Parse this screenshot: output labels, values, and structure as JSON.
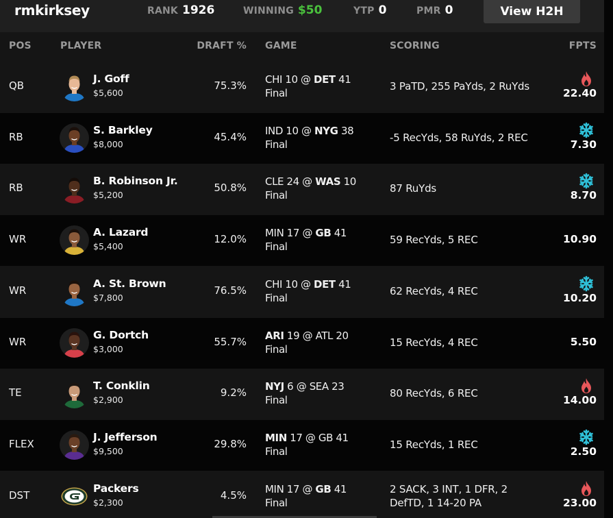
{
  "header": {
    "username": "rmkirksey",
    "rank_label": "RANK",
    "rank_value": "1926",
    "winning_label": "WINNING",
    "winning_value": "$50",
    "ytp_label": "YTP",
    "ytp_value": "0",
    "pmr_label": "PMR",
    "pmr_value": "0",
    "view_h2h_label": "View H2H"
  },
  "columns": {
    "pos": "POS",
    "player": "PLAYER",
    "draft": "DRAFT %",
    "game": "GAME",
    "scoring": "SCORING",
    "fpts": "FPTS"
  },
  "colors": {
    "winning_green": "#4ac13d",
    "hot_red": "#e8575a",
    "cold_cyan": "#2fc0d8"
  },
  "rows": [
    {
      "pos": "QB",
      "name": "J. Goff",
      "salary": "$5,600",
      "draft": "75.3%",
      "away": "CHI",
      "away_score": "10",
      "home": "DET",
      "home_score": "41",
      "bold_team": "home",
      "status": "Final",
      "scoring": "3 PaTD, 255 PaYds, 2 RuYds",
      "fpts": "22.40",
      "trend": "hot",
      "trend_icon": "flame-icon",
      "jersey": "#1f77c5",
      "skin": "#e7b896",
      "hair": "#b08a55"
    },
    {
      "pos": "RB",
      "name": "S. Barkley",
      "salary": "$8,000",
      "draft": "45.4%",
      "away": "IND",
      "away_score": "10",
      "home": "NYG",
      "home_score": "38",
      "bold_team": "home",
      "status": "Final",
      "scoring": "-5 RecYds, 58 RuYds, 2 REC",
      "fpts": "7.30",
      "trend": "cold",
      "trend_icon": "snowflake-icon",
      "jersey": "#2a4fc0",
      "skin": "#6b3f25",
      "hair": "#1a0f0a"
    },
    {
      "pos": "RB",
      "name": "B. Robinson Jr.",
      "salary": "$5,200",
      "draft": "50.8%",
      "away": "CLE",
      "away_score": "24",
      "home": "WAS",
      "home_score": "10",
      "bold_team": "home",
      "status": "Final",
      "scoring": "87 RuYds",
      "fpts": "8.70",
      "trend": "cold",
      "trend_icon": "snowflake-icon",
      "jersey": "#8a1d25",
      "skin": "#4f2e1c",
      "hair": "#140c08"
    },
    {
      "pos": "WR",
      "name": "A. Lazard",
      "salary": "$5,400",
      "draft": "12.0%",
      "away": "MIN",
      "away_score": "17",
      "home": "GB",
      "home_score": "41",
      "bold_team": "home",
      "status": "Final",
      "scoring": "59 RecYds, 5 REC",
      "fpts": "10.90",
      "trend": "none",
      "trend_icon": "",
      "jersey": "#d9b238",
      "skin": "#8a5a3a",
      "hair": "#1a100a"
    },
    {
      "pos": "WR",
      "name": "A. St. Brown",
      "salary": "$7,800",
      "draft": "76.5%",
      "away": "CHI",
      "away_score": "10",
      "home": "DET",
      "home_score": "41",
      "bold_team": "home",
      "status": "Final",
      "scoring": "62 RecYds, 4 REC",
      "fpts": "10.20",
      "trend": "cold",
      "trend_icon": "snowflake-icon",
      "jersey": "#1f77c5",
      "skin": "#9a6440",
      "hair": "#1a100a"
    },
    {
      "pos": "WR",
      "name": "G. Dortch",
      "salary": "$3,000",
      "draft": "55.7%",
      "away": "ARI",
      "away_score": "19",
      "home": "ATL",
      "home_score": "20",
      "bold_team": "away",
      "status": "Final",
      "scoring": "15 RecYds, 4 REC",
      "fpts": "5.50",
      "trend": "none",
      "trend_icon": "",
      "jersey": "#d6404a",
      "skin": "#5a3422",
      "hair": "#2a120c"
    },
    {
      "pos": "TE",
      "name": "T. Conklin",
      "salary": "$2,900",
      "draft": "9.2%",
      "away": "NYJ",
      "away_score": "6",
      "home": "SEA",
      "home_score": "23",
      "bold_team": "away",
      "status": "Final",
      "scoring": "80 RecYds, 6 REC",
      "fpts": "14.00",
      "trend": "hot",
      "trend_icon": "flame-icon",
      "jersey": "#1e6a3a",
      "skin": "#c99a78",
      "hair": "#1a1410"
    },
    {
      "pos": "FLEX",
      "name": "J. Jefferson",
      "salary": "$9,500",
      "draft": "29.8%",
      "away": "MIN",
      "away_score": "17",
      "home": "GB",
      "home_score": "41",
      "bold_team": "away",
      "status": "Final",
      "scoring": "15 RecYds, 1 REC",
      "fpts": "2.50",
      "trend": "cold",
      "trend_icon": "snowflake-icon",
      "jersey": "#5a2d91",
      "skin": "#6a4028",
      "hair": "#2a1a10"
    },
    {
      "pos": "DST",
      "name": "Packers",
      "salary": "$2,300",
      "draft": "4.5%",
      "away": "MIN",
      "away_score": "17",
      "home": "GB",
      "home_score": "41",
      "bold_team": "home",
      "status": "Final",
      "scoring": "2 SACK, 3 INT, 1 DFR, 2 DefTD, 1 14-20 PA",
      "fpts": "23.00",
      "trend": "hot",
      "trend_icon": "flame-icon",
      "logo": "packers-logo"
    }
  ]
}
